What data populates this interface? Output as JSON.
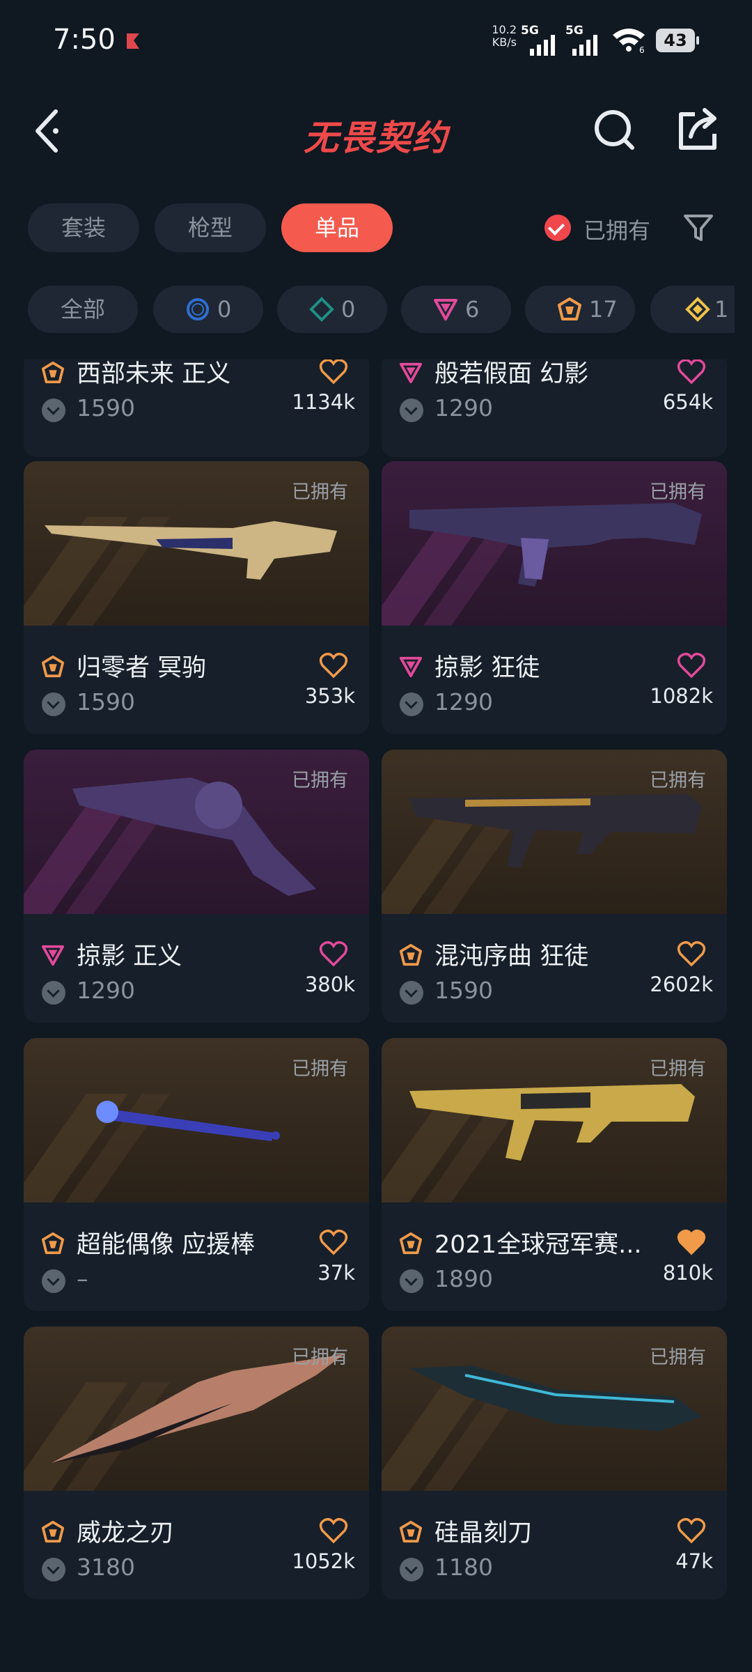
{
  "status_bar": {
    "time": "7:50",
    "net_speed": "10.2",
    "net_unit": "KB/s",
    "sim1": "5G",
    "sim2": "5G",
    "wifi_badge": "6",
    "battery": "43"
  },
  "header": {
    "title": "无畏契约",
    "icons": [
      "back-icon",
      "search-icon",
      "share-icon"
    ]
  },
  "tabs": {
    "items": [
      "套装",
      "枪型",
      "单品"
    ],
    "active": "单品",
    "owned_filter_label": "已拥有"
  },
  "tiers": [
    {
      "label": "全部"
    },
    {
      "count": "0",
      "color": "#2f6fd0"
    },
    {
      "count": "0",
      "color": "#1f8f85"
    },
    {
      "count": "6",
      "color": "#e24a9a"
    },
    {
      "count": "17",
      "color": "#f09a4a"
    },
    {
      "count": "1",
      "color": "#f0c24a"
    }
  ],
  "items": [
    {
      "name": "西部未来 正义",
      "price": "1590",
      "likes": "1134k",
      "tier": "orange"
    },
    {
      "name": "般若假面 幻影",
      "price": "1290",
      "likes": "654k",
      "tier": "pink"
    },
    {
      "name": "归零者 冥驹",
      "price": "1590",
      "likes": "353k",
      "tier": "orange",
      "owned": "已拥有"
    },
    {
      "name": "掠影 狂徒",
      "price": "1290",
      "likes": "1082k",
      "tier": "pink",
      "owned": "已拥有"
    },
    {
      "name": "掠影 正义",
      "price": "1290",
      "likes": "380k",
      "tier": "pink",
      "owned": "已拥有"
    },
    {
      "name": "混沌序曲 狂徒",
      "price": "1590",
      "likes": "2602k",
      "tier": "orange",
      "owned": "已拥有"
    },
    {
      "name": "超能偶像 应援棒",
      "price": "–",
      "likes": "37k",
      "tier": "orange",
      "owned": "已拥有"
    },
    {
      "name": "2021全球冠军赛...",
      "price": "1890",
      "likes": "810k",
      "tier": "orange",
      "owned": "已拥有",
      "liked": true
    },
    {
      "name": "威龙之刃",
      "price": "3180",
      "likes": "1052k",
      "tier": "orange",
      "owned": "已拥有"
    },
    {
      "name": "硅晶刻刀",
      "price": "1180",
      "likes": "47k",
      "tier": "orange",
      "owned": "已拥有"
    }
  ]
}
